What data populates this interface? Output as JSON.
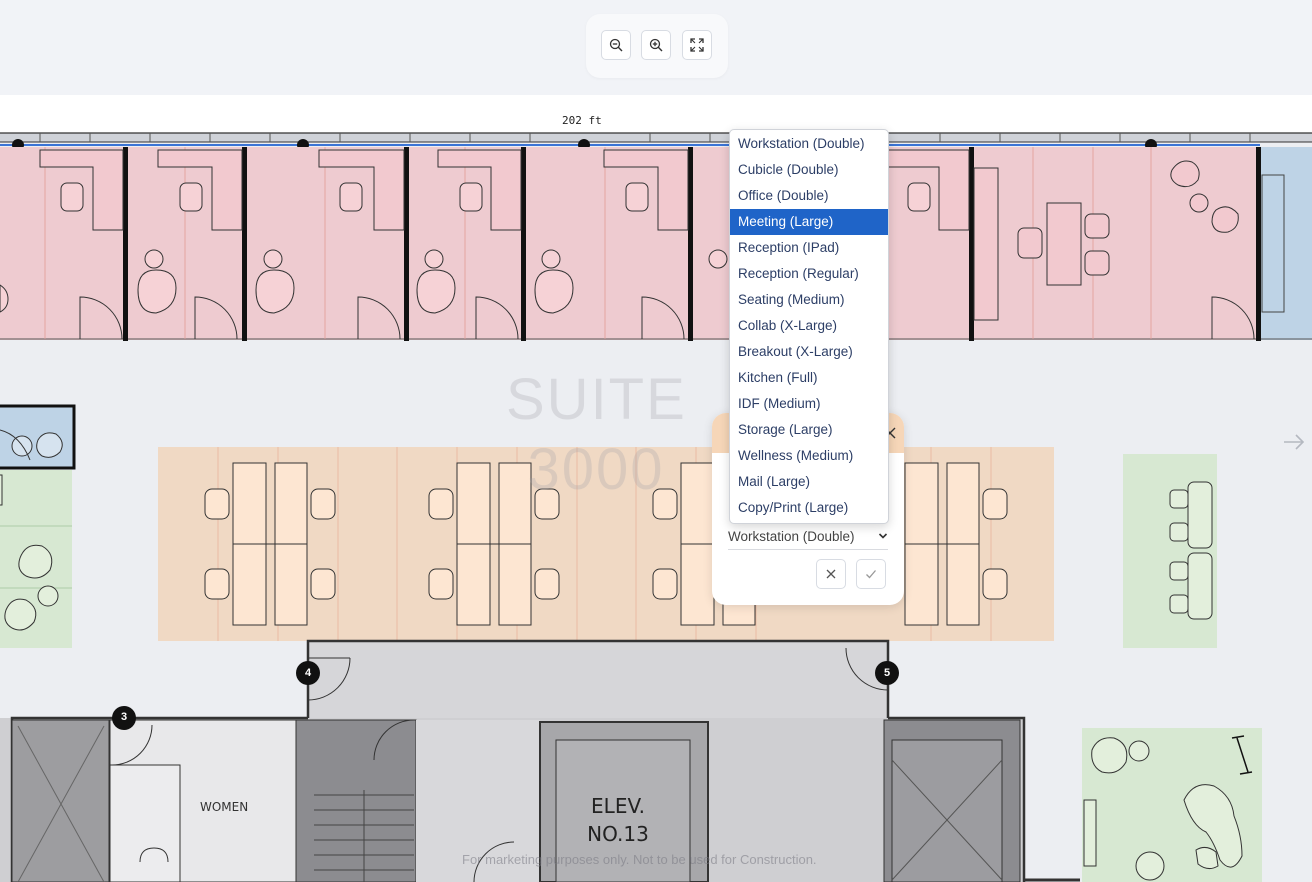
{
  "toolbar": {
    "zoom_out_icon": "zoom-out-icon",
    "zoom_in_icon": "zoom-in-icon",
    "fit_icon": "fullscreen-icon"
  },
  "floorplan": {
    "scale_label": "202 ft",
    "suite_label_line1": "SUITE",
    "suite_label_line2": "3000",
    "room_women": "WOMEN",
    "elevator_line1": "ELEV.",
    "elevator_line2": "NO.13",
    "markers": [
      "3",
      "4",
      "5"
    ],
    "disclaimer": "For marketing purposes only. Not to be used for Construction."
  },
  "editor": {
    "selected_value": "Workstation (Double)"
  },
  "dropdown": {
    "options": [
      "Workstation (Double)",
      "Cubicle (Double)",
      "Office (Double)",
      "Meeting (Large)",
      "Reception (IPad)",
      "Reception (Regular)",
      "Seating (Medium)",
      "Collab (X-Large)",
      "Breakout (X-Large)",
      "Kitchen (Full)",
      "IDF (Medium)",
      "Storage (Large)",
      "Wellness (Medium)",
      "Mail (Large)",
      "Copy/Print (Large)"
    ],
    "highlighted": "Meeting (Large)"
  },
  "colors": {
    "office_fill": "#eeccd1",
    "workstation_fill": "#f7dfc8",
    "collab_fill": "#d7e8d2",
    "accent": "#1f64c8"
  }
}
